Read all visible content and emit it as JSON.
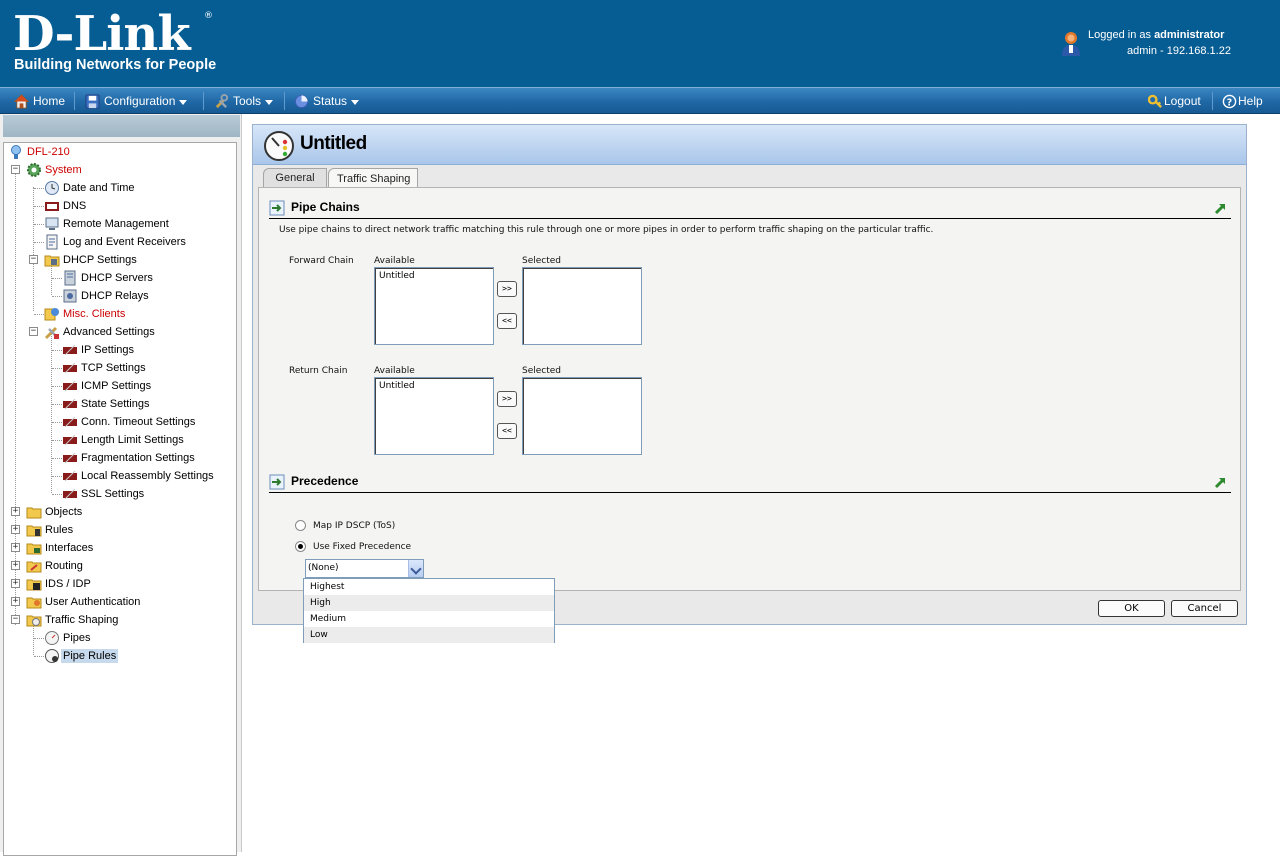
{
  "header": {
    "logo_main": "D-Link",
    "logo_registered": "®",
    "logo_tagline": "Building Networks for People",
    "logged_in_prefix": "Logged in as",
    "logged_in_user": "administrator",
    "session_info": "admin - 192.168.1.22"
  },
  "menubar": {
    "home": "Home",
    "configuration": "Configuration",
    "tools": "Tools",
    "status": "Status",
    "logout": "Logout",
    "help": "Help"
  },
  "tree": {
    "root": "DFL-210",
    "system": "System",
    "date_time": "Date and Time",
    "dns": "DNS",
    "remote_management": "Remote Management",
    "log_event_receivers": "Log and Event Receivers",
    "dhcp_settings": "DHCP Settings",
    "dhcp_servers": "DHCP Servers",
    "dhcp_relays": "DHCP Relays",
    "misc_clients": "Misc. Clients",
    "advanced_settings": "Advanced Settings",
    "ip_settings": "IP Settings",
    "tcp_settings": "TCP Settings",
    "icmp_settings": "ICMP Settings",
    "state_settings": "State Settings",
    "conn_timeout": "Conn. Timeout Settings",
    "length_limit": "Length Limit Settings",
    "fragmentation": "Fragmentation Settings",
    "local_reassembly": "Local Reassembly Settings",
    "ssl_settings": "SSL Settings",
    "objects": "Objects",
    "rules": "Rules",
    "interfaces": "Interfaces",
    "routing": "Routing",
    "ids_idp": "IDS / IDP",
    "user_auth": "User Authentication",
    "traffic_shaping": "Traffic Shaping",
    "pipes": "Pipes",
    "pipe_rules": "Pipe Rules"
  },
  "panel": {
    "title": "Untitled",
    "tabs": [
      "General",
      "Traffic Shaping"
    ],
    "active_tab": "Traffic Shaping"
  },
  "pipe_chains": {
    "heading": "Pipe Chains",
    "description": "Use pipe chains to direct network traffic matching this rule through one or more pipes in order to perform traffic shaping on the particular traffic.",
    "forward_label": "Forward Chain",
    "return_label": "Return Chain",
    "available_label": "Available",
    "selected_label": "Selected",
    "forward_available": [
      "Untitled"
    ],
    "forward_selected": [],
    "return_available": [
      "Untitled"
    ],
    "return_selected": [],
    "add_button": ">>",
    "remove_button": "<<"
  },
  "precedence": {
    "heading": "Precedence",
    "option_map": "Map IP DSCP (ToS)",
    "option_fixed": "Use Fixed Precedence",
    "selected_option": "Use Fixed Precedence",
    "select_value": "(None)",
    "dropdown_options": [
      "Highest",
      "High",
      "Medium",
      "Low"
    ]
  },
  "buttons": {
    "ok": "OK",
    "cancel": "Cancel"
  },
  "colors": {
    "header_bg": "#065d93",
    "menubar_bg": "#1f68a6",
    "tree_red": "#cc0000",
    "panel_head": "#a9c6ea"
  }
}
